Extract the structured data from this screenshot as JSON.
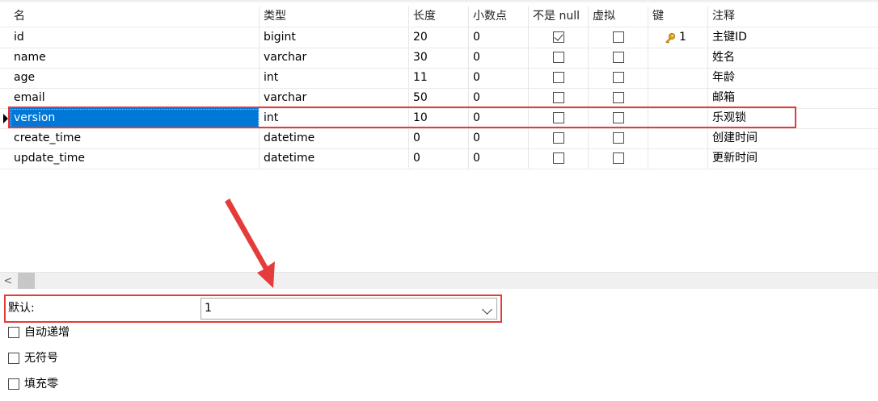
{
  "grid": {
    "columns": [
      "名",
      "类型",
      "长度",
      "小数点",
      "不是 null",
      "虚拟",
      "键",
      "注释"
    ],
    "rows": [
      {
        "name": "id",
        "type": "bigint",
        "length": "20",
        "decimal": "0",
        "not_null": true,
        "virtual": false,
        "key": "1",
        "comment": "主键ID"
      },
      {
        "name": "name",
        "type": "varchar",
        "length": "30",
        "decimal": "0",
        "not_null": false,
        "virtual": false,
        "key": "",
        "comment": "姓名"
      },
      {
        "name": "age",
        "type": "int",
        "length": "11",
        "decimal": "0",
        "not_null": false,
        "virtual": false,
        "key": "",
        "comment": "年龄"
      },
      {
        "name": "email",
        "type": "varchar",
        "length": "50",
        "decimal": "0",
        "not_null": false,
        "virtual": false,
        "key": "",
        "comment": "邮箱"
      },
      {
        "name": "version",
        "type": "int",
        "length": "10",
        "decimal": "0",
        "not_null": false,
        "virtual": false,
        "key": "",
        "comment": "乐观锁"
      },
      {
        "name": "create_time",
        "type": "datetime",
        "length": "0",
        "decimal": "0",
        "not_null": false,
        "virtual": false,
        "key": "",
        "comment": "创建时间"
      },
      {
        "name": "update_time",
        "type": "datetime",
        "length": "0",
        "decimal": "0",
        "not_null": false,
        "virtual": false,
        "key": "",
        "comment": "更新时间"
      }
    ],
    "selected_row": 4,
    "key_icon": "key-icon"
  },
  "scrollbar": {
    "left_glyph": "<"
  },
  "panel": {
    "default_label": "默认:",
    "default_value": "1",
    "options": [
      {
        "label": "自动递增",
        "checked": false
      },
      {
        "label": "无符号",
        "checked": false
      },
      {
        "label": "填充零",
        "checked": false
      }
    ]
  },
  "annotations": {
    "highlight_color": "#e63b3b",
    "selection_color": "#0078d7"
  }
}
